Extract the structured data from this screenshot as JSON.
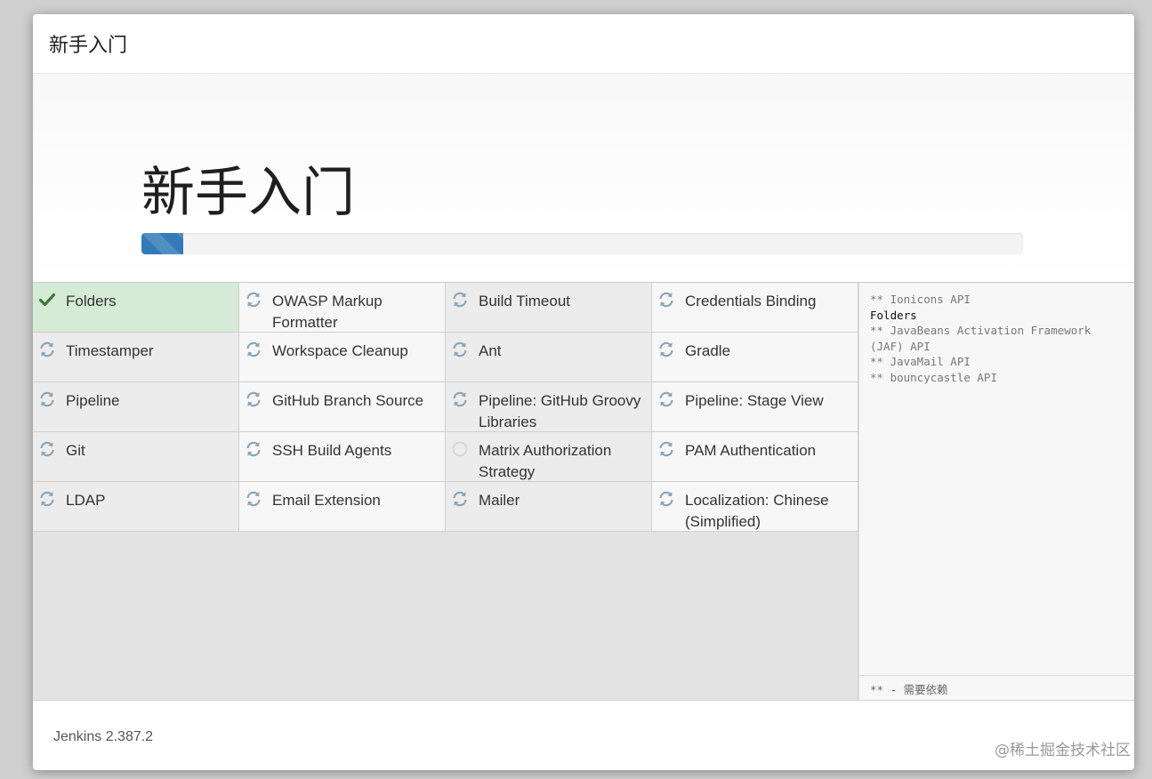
{
  "header": {
    "title": "新手入门"
  },
  "hero": {
    "title": "新手入门",
    "progress": 0.047
  },
  "plugins": [
    {
      "label": "Folders",
      "status": "done",
      "icon": "check-icon"
    },
    {
      "label": "OWASP Markup Formatter",
      "status": "pending",
      "icon": "refresh-icon"
    },
    {
      "label": "Build Timeout",
      "status": "pending",
      "icon": "refresh-icon"
    },
    {
      "label": "Credentials Binding",
      "status": "pending",
      "icon": "refresh-icon"
    },
    {
      "label": "Timestamper",
      "status": "pending",
      "icon": "refresh-icon"
    },
    {
      "label": "Workspace Cleanup",
      "status": "pending",
      "icon": "refresh-icon"
    },
    {
      "label": "Ant",
      "status": "pending",
      "icon": "refresh-icon"
    },
    {
      "label": "Gradle",
      "status": "pending",
      "icon": "refresh-icon"
    },
    {
      "label": "Pipeline",
      "status": "pending",
      "icon": "refresh-icon"
    },
    {
      "label": "GitHub Branch Source",
      "status": "pending",
      "icon": "refresh-icon"
    },
    {
      "label": "Pipeline: GitHub Groovy Libraries",
      "status": "pending",
      "icon": "refresh-icon"
    },
    {
      "label": "Pipeline: Stage View",
      "status": "pending",
      "icon": "refresh-icon"
    },
    {
      "label": "Git",
      "status": "pending",
      "icon": "refresh-icon"
    },
    {
      "label": "SSH Build Agents",
      "status": "pending",
      "icon": "refresh-icon"
    },
    {
      "label": "Matrix Authorization Strategy",
      "status": "not-started",
      "icon": "circle-icon"
    },
    {
      "label": "PAM Authentication",
      "status": "pending",
      "icon": "refresh-icon"
    },
    {
      "label": "LDAP",
      "status": "pending",
      "icon": "refresh-icon"
    },
    {
      "label": "Email Extension",
      "status": "pending",
      "icon": "refresh-icon"
    },
    {
      "label": "Mailer",
      "status": "pending",
      "icon": "refresh-icon"
    },
    {
      "label": "Localization: Chinese (Simplified)",
      "status": "pending",
      "icon": "refresh-icon"
    }
  ],
  "log": {
    "lines": [
      {
        "text": "** Ionicons API",
        "current": false
      },
      {
        "text": "Folders",
        "current": true
      },
      {
        "text": "** JavaBeans Activation Framework (JAF) API",
        "current": false
      },
      {
        "text": "** JavaMail API",
        "current": false
      },
      {
        "text": "** bouncycastle API",
        "current": false
      }
    ],
    "legend": "** - 需要依赖"
  },
  "footer": {
    "version": "Jenkins 2.387.2"
  },
  "watermark": "@稀土掘金技术社区",
  "colors": {
    "accent": "#337ab7",
    "done": "#d5ebd5",
    "check": "#3c763d",
    "spinner": "#8aa4b8"
  }
}
